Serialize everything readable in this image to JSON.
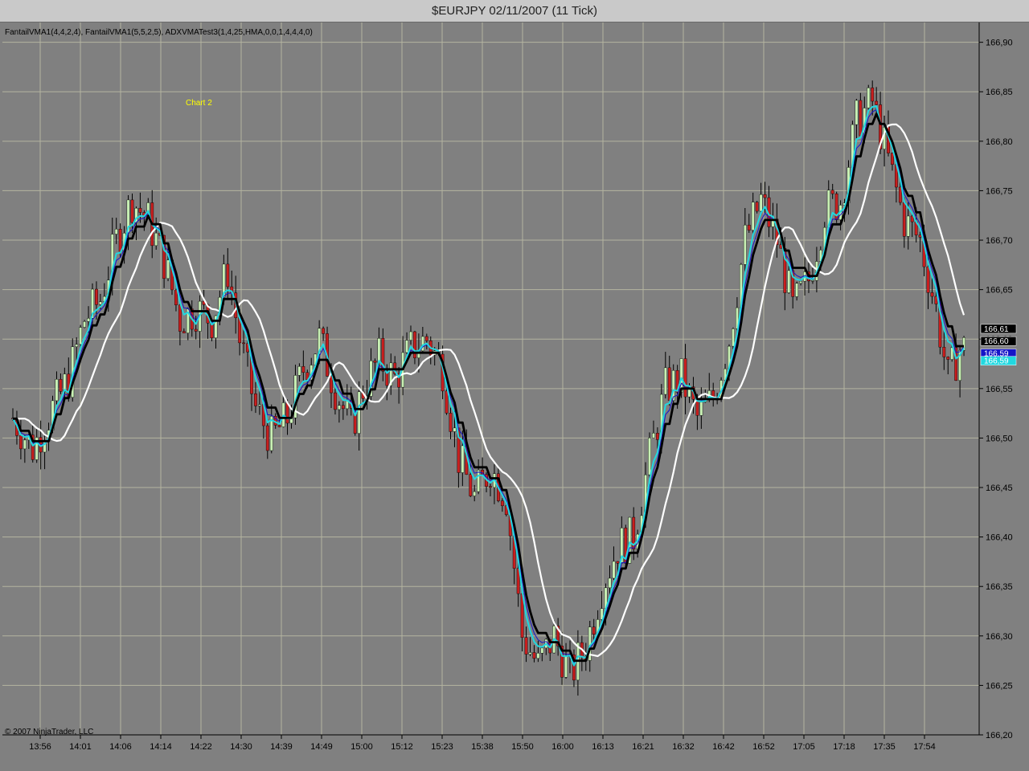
{
  "window": {
    "title": "$EURJPY  02/11/2007  (11 Tick)"
  },
  "chart_data": {
    "type": "candlestick",
    "indicator_text": "FantailVMA1(4,4,2,4), FantailVMA1(5,5,2,5), ADXVMATest3(1,4,25,HMA,0,0,1,4,4,4,0)",
    "panel_label": "Chart 2",
    "copyright": "© 2007 NinjaTrader, LLC",
    "ylim": [
      166.2,
      166.92
    ],
    "y_ticks": [
      "166,90",
      "166,85",
      "166,80",
      "166,75",
      "166,70",
      "166,65",
      "166,60",
      "166,55",
      "166,50",
      "166,45",
      "166,40",
      "166,35",
      "166,30",
      "166,25",
      "166,20"
    ],
    "x_ticks": [
      "13:56",
      "14:01",
      "14:06",
      "14:14",
      "14:22",
      "14:30",
      "14:39",
      "14:49",
      "15:00",
      "15:12",
      "15:23",
      "15:38",
      "15:50",
      "16:00",
      "16:13",
      "16:21",
      "16:32",
      "16:42",
      "16:52",
      "17:05",
      "17:18",
      "17:35",
      "17:54"
    ],
    "price_labels": [
      {
        "text": "166,61",
        "value": 166.61,
        "color": "#000000"
      },
      {
        "text": "166,60",
        "value": 166.6,
        "color": "#000000"
      },
      {
        "text": "166,59",
        "value": 166.59,
        "color": "#1515c8"
      },
      {
        "text": "166,59",
        "value": 166.585,
        "color": "#21d8e0"
      }
    ],
    "anchors": [
      [
        0,
        166.52
      ],
      [
        5,
        166.49
      ],
      [
        10,
        166.53
      ],
      [
        14,
        166.56
      ],
      [
        18,
        166.62
      ],
      [
        22,
        166.64
      ],
      [
        26,
        166.7
      ],
      [
        30,
        166.74
      ],
      [
        34,
        166.72
      ],
      [
        38,
        166.68
      ],
      [
        42,
        166.62
      ],
      [
        46,
        166.63
      ],
      [
        50,
        166.62
      ],
      [
        54,
        166.67
      ],
      [
        57,
        166.6
      ],
      [
        61,
        166.53
      ],
      [
        65,
        166.5
      ],
      [
        69,
        166.52
      ],
      [
        73,
        166.57
      ],
      [
        77,
        166.6
      ],
      [
        81,
        166.55
      ],
      [
        85,
        166.51
      ],
      [
        88,
        166.55
      ],
      [
        92,
        166.58
      ],
      [
        96,
        166.56
      ],
      [
        100,
        166.59
      ],
      [
        104,
        166.6
      ],
      [
        108,
        166.57
      ],
      [
        112,
        166.48
      ],
      [
        116,
        166.44
      ],
      [
        120,
        166.47
      ],
      [
        124,
        166.44
      ],
      [
        128,
        166.3
      ],
      [
        132,
        166.27
      ],
      [
        136,
        166.3
      ],
      [
        140,
        166.26
      ],
      [
        144,
        166.29
      ],
      [
        148,
        166.35
      ],
      [
        152,
        166.39
      ],
      [
        156,
        166.4
      ],
      [
        160,
        166.48
      ],
      [
        164,
        166.55
      ],
      [
        168,
        166.56
      ],
      [
        172,
        166.52
      ],
      [
        176,
        166.54
      ],
      [
        180,
        166.6
      ],
      [
        184,
        166.7
      ],
      [
        188,
        166.74
      ],
      [
        192,
        166.7
      ],
      [
        196,
        166.63
      ],
      [
        200,
        166.66
      ],
      [
        204,
        166.73
      ],
      [
        208,
        166.74
      ],
      [
        212,
        166.82
      ],
      [
        216,
        166.84
      ],
      [
        220,
        166.78
      ],
      [
        224,
        166.72
      ],
      [
        228,
        166.7
      ],
      [
        232,
        166.63
      ],
      [
        235,
        166.56
      ],
      [
        238,
        166.59
      ]
    ],
    "seed": 7,
    "series": [
      {
        "color": "#000000"
      },
      {
        "color": "#1515c8"
      },
      {
        "color": "#21d8e0"
      },
      {
        "color": "#ffffff"
      }
    ],
    "colors": {
      "background": "#808080",
      "grid": "#b4b4a0",
      "up": "#c8f0b4",
      "down": "#c81e1e",
      "title_bar": "#c9c9c9",
      "axis_text": "#000000",
      "panel_label": "#ffff00"
    }
  }
}
